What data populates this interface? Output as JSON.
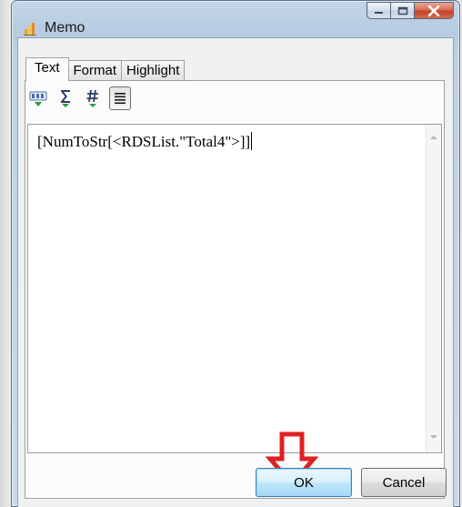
{
  "window": {
    "title": "Memo"
  },
  "tabs": [
    {
      "label": "Text",
      "active": true
    },
    {
      "label": "Format",
      "active": false
    },
    {
      "label": "Highlight",
      "active": false
    }
  ],
  "toolbar": {
    "items": [
      {
        "icon": "spellcheck-abc-icon"
      },
      {
        "icon": "sigma-sum-icon",
        "glyph": "Σ"
      },
      {
        "icon": "hash-format-icon",
        "glyph": "#"
      },
      {
        "icon": "word-wrap-icon",
        "pressed": true
      }
    ]
  },
  "memo": {
    "value": "[NumToStr[<RDSList.\"Total4\">]]"
  },
  "buttons": {
    "ok_label": "OK",
    "cancel_label": "Cancel"
  },
  "colors": {
    "annotation_arrow": "#e02020",
    "ok_button_accent": "#3c7fb1"
  }
}
